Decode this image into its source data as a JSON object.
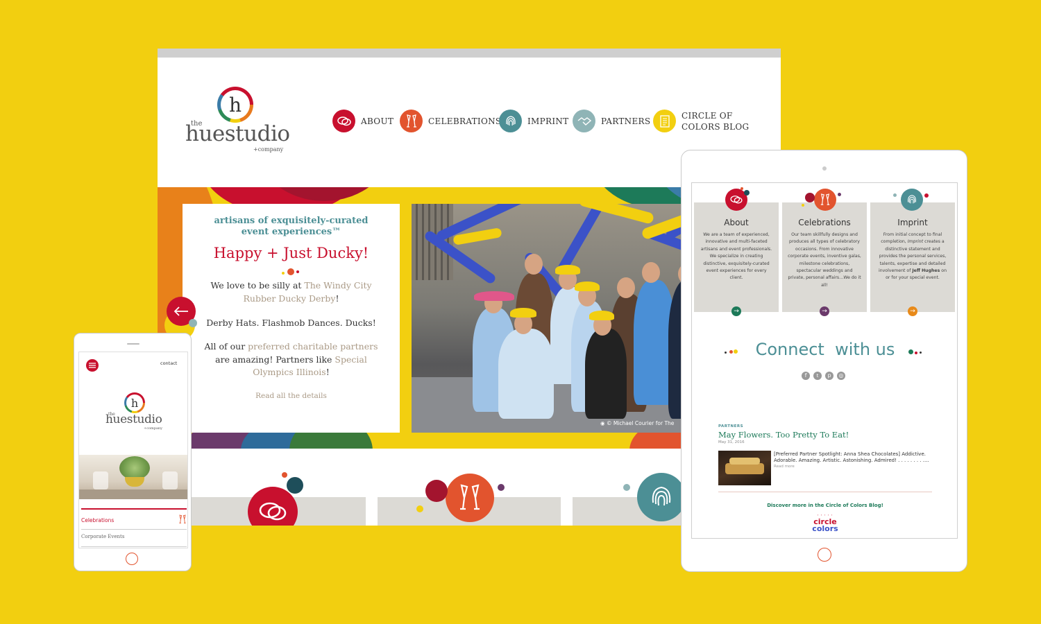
{
  "colors": {
    "background": "#f2cf10",
    "red": "#c8102e",
    "orange": "#e2542e",
    "teal": "#4c8f95",
    "sage": "#8fb4b6",
    "yellow": "#f2cf10",
    "green": "#1d7a59",
    "purple": "#6b3a6b",
    "amber": "#e88a1a"
  },
  "brand": {
    "the": "the",
    "name": "huestudio",
    "company": "+company",
    "letter": "h"
  },
  "nav": [
    {
      "label": "ABOUT",
      "icon": "speech-bubbles-icon",
      "color": "#c8102e"
    },
    {
      "label": "CELEBRATIONS",
      "icon": "champagne-glasses-icon",
      "color": "#e2542e"
    },
    {
      "label": "IMPRINT",
      "icon": "fingerprint-icon",
      "color": "#4c8f95"
    },
    {
      "label": "PARTNERS",
      "icon": "handshake-icon",
      "color": "#8fb4b6"
    },
    {
      "label_line1": "CIRCLE OF",
      "label_line2": "COLORS BLOG",
      "icon": "notepad-icon",
      "color": "#f2cf10"
    }
  ],
  "hero": {
    "tagline_line1": "artisans of exquisitely-curated",
    "tagline_line2": "event experiences™",
    "title": "Happy + Just Ducky!",
    "p1_pre": "We love to be silly at ",
    "p1_link": "The Windy City Rubber Ducky Derby",
    "p1_post": "!",
    "p2": "Derby Hats. Flashmob Dances. Ducks!",
    "p3_pre": "All of our ",
    "p3_link1": "preferred charitable partners",
    "p3_mid": " are amazing! Partners like ",
    "p3_link2": "Special Olympics Illinois",
    "p3_post": "!",
    "read_more": "Read all the details",
    "photo_credit": "© Michael Courier for The"
  },
  "phone": {
    "contact": "contact",
    "menu_item_active": "Celebrations",
    "menu_item_2": "Corporate Events"
  },
  "tablet": {
    "cards": [
      {
        "title": "About",
        "text": "We are a team of experienced, innovative and multi-faceted artisans and event professionals. We specialize in creating distinctive, exquisitely-curated event experiences for every client."
      },
      {
        "title": "Celebrations",
        "text": "Our team skillfully designs and produces all types of celebratory occasions. From innovative corporate events, inventive galas, milestone celebrations, spectacular weddings and private, personal affairs…We do it all!"
      },
      {
        "title": "Imprint",
        "text_pre": "From initial concept to final completion, ",
        "text_em": "Imprint",
        "text_mid": " creates a distinctive statement and provides the personal services, talents, expertise and detailed involvement of ",
        "text_strong": "Jeff Hughes",
        "text_post": " on or for your special event."
      }
    ],
    "connect_word1": "Connect",
    "connect_word2": "with us",
    "social": [
      "facebook-icon",
      "twitter-icon",
      "pinterest-icon",
      "instagram-icon"
    ],
    "post_category": "PARTNERS",
    "post_title": "May Flowers. Too Pretty To Eat!",
    "post_date": "May 31, 2016",
    "post_excerpt": "[Preferred Partner Spotlight: Anna Shea Chocolates] Addictive. Adorable. Amazing. Artistic. Astonishing. Admired! . . . . . . . . ....",
    "post_read_more": "Read more",
    "discover": "Discover more in the Circle of Colors Blog!",
    "logo_line1": "circle",
    "logo_line2": "colors"
  }
}
